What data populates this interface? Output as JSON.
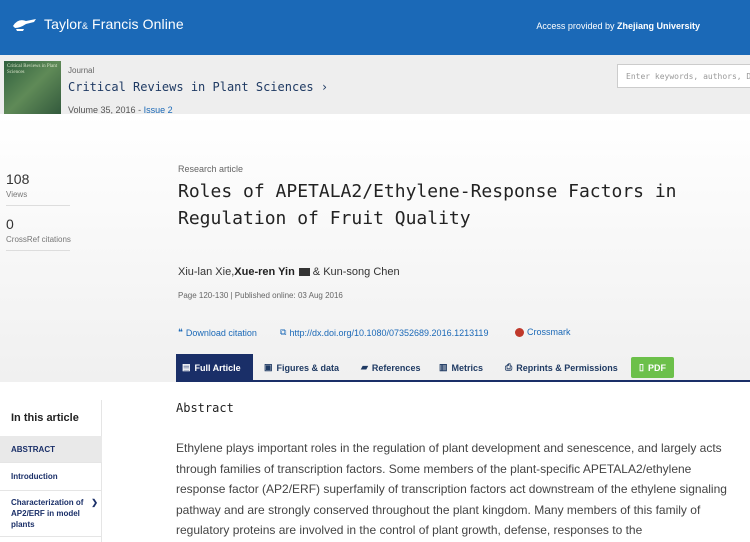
{
  "header": {
    "brand_main": "Taylor",
    "brand_amp": "&",
    "brand_rest": " Francis Online",
    "access_prefix": "Access provided by ",
    "access_institution": "Zhejiang University"
  },
  "journal": {
    "label": "Journal",
    "title": "Critical Reviews in Plant Sciences",
    "title_arrow": "›",
    "volume": "Volume 35, 2016",
    "sep": " - ",
    "issue": "Issue 2",
    "cover_text": "Critical Reviews in Plant Sciences"
  },
  "search": {
    "placeholder": "Enter keywords, authors, DOI"
  },
  "stats": {
    "views_count": "108",
    "views_label": "Views",
    "crossref_count": "0",
    "crossref_label": "CrossRef citations"
  },
  "article": {
    "type": "Research article",
    "title_line1": "Roles of APETALA2/Ethylene-Response Factors in",
    "title_line2": "Regulation of Fruit Quality",
    "author1": "Xiu-lan Xie, ",
    "author2": "Xue-ren Yin",
    "author3": "& Kun-song Chen",
    "page_info": "Page 120-130 | Published online: 03 Aug 2016"
  },
  "links": {
    "download_citation": "Download citation",
    "doi": "http://dx.doi.org/10.1080/07352689.2016.1213119",
    "crossmark": "Crossmark"
  },
  "tabs": {
    "full_article": "Full Article",
    "figures": "Figures & data",
    "references": "References",
    "metrics": "Metrics",
    "reprints": "Reprints & Permissions",
    "pdf": "PDF"
  },
  "nav": {
    "title": "In this article",
    "items": [
      "ABSTRACT",
      "Introduction",
      "Characterization of AP2/ERF in model plants"
    ]
  },
  "abstract": {
    "heading": "Abstract",
    "text": "Ethylene plays important roles in the regulation of plant development and senescence, and largely acts through families of transcription factors. Some members of the plant-specific APETALA2/ethylene response factor (AP2/ERF) superfamily of transcription factors act downstream of the ethylene signaling pathway and are strongly conserved throughout the plant kingdom. Many members of this family of regulatory proteins are involved in the control of plant growth, defense, responses to the"
  },
  "colors": {
    "brand_blue": "#1b69b7",
    "tab_navy": "#1a2f68",
    "pdf_green": "#6cc04a"
  }
}
